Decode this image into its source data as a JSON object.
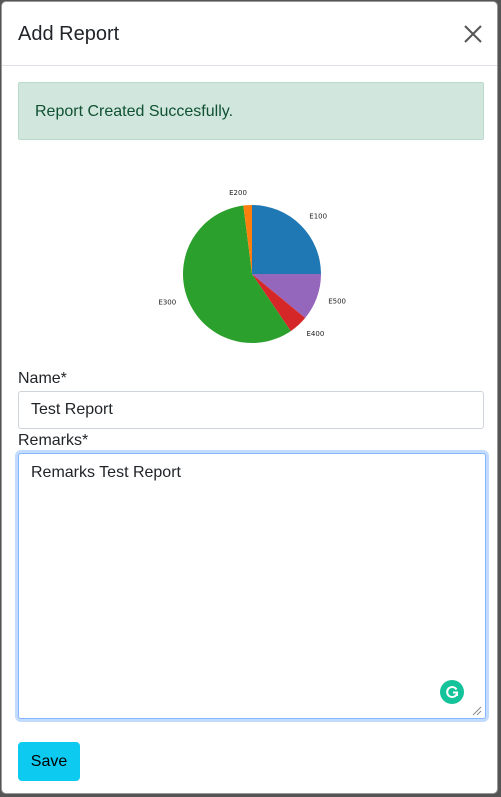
{
  "modal": {
    "title": "Add Report",
    "alert_text": "Report Created Succesfully."
  },
  "form": {
    "name_label": "Name*",
    "name_value": "Test Report",
    "remarks_label": "Remarks*",
    "remarks_value": "Remarks Test Report",
    "save_label": "Save"
  },
  "icons": {
    "close": "close-icon",
    "grammarly": "grammarly-icon",
    "resize": "resize-handle-icon"
  },
  "colors": {
    "alert_bg": "#d1e7dd",
    "alert_text": "#0f5132",
    "save_button": "#0dcaf0",
    "focus_border": "#86b7fe"
  },
  "chart_data": {
    "type": "pie",
    "title": "",
    "slices": [
      {
        "label": "E100",
        "value": 25.0,
        "color": "#1f77b4"
      },
      {
        "label": "E500",
        "value": 11.0,
        "color": "#9467bd"
      },
      {
        "label": "E400",
        "value": 4.5,
        "color": "#d62728"
      },
      {
        "label": "E300",
        "value": 57.5,
        "color": "#2ca02c"
      },
      {
        "label": "E200",
        "value": 2.0,
        "color": "#ff7f0e"
      }
    ]
  }
}
